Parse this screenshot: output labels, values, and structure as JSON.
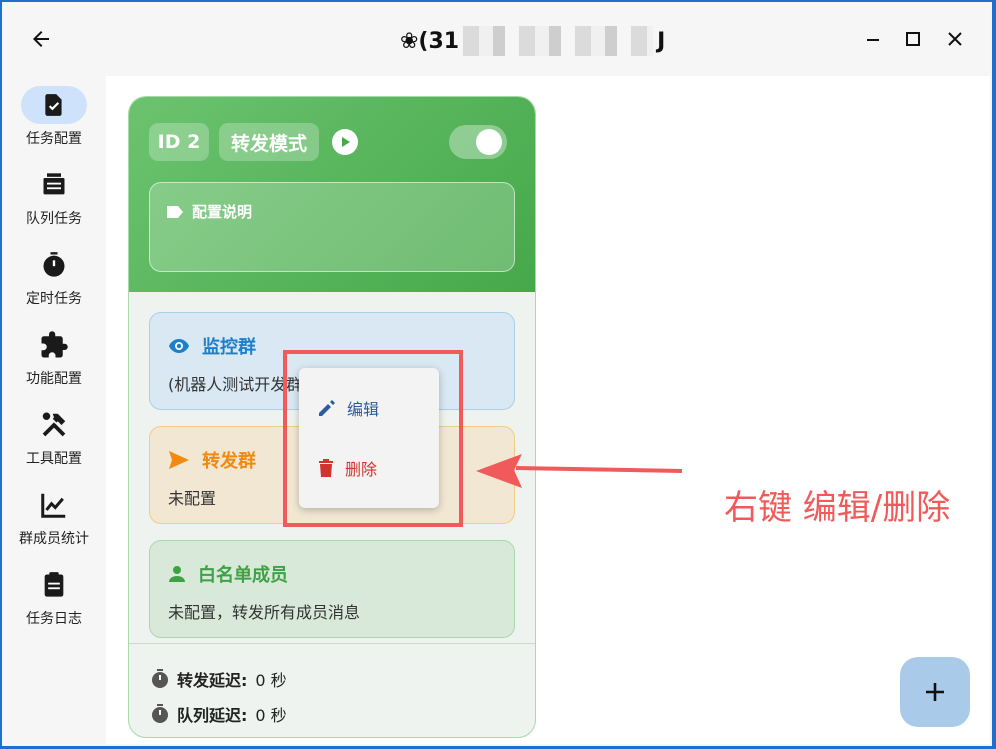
{
  "titlebar": {
    "title_prefix": "❀(31",
    "title_suffix": "J"
  },
  "sidebar": {
    "items": [
      {
        "label": "任务配置",
        "icon": "task-config-icon",
        "active": true
      },
      {
        "label": "队列任务",
        "icon": "queue-icon"
      },
      {
        "label": "定时任务",
        "icon": "timer-icon"
      },
      {
        "label": "功能配置",
        "icon": "puzzle-icon"
      },
      {
        "label": "工具配置",
        "icon": "tools-icon"
      },
      {
        "label": "群成员统计",
        "icon": "chart-icon"
      },
      {
        "label": "任务日志",
        "icon": "clipboard-icon"
      }
    ]
  },
  "card": {
    "id_label": "ID 2",
    "mode_label": "转发模式",
    "toggle_on": true,
    "desc_label": "配置说明",
    "monitor": {
      "title": "监控群",
      "subtitle": "(机器人测试开发群)"
    },
    "forward": {
      "title": "转发群",
      "subtitle": "未配置"
    },
    "whitelist": {
      "title": "白名单成员",
      "subtitle": "未配置，转发所有成员消息"
    },
    "forward_delay": {
      "label": "转发延迟:",
      "value": "0 秒"
    },
    "queue_delay": {
      "label": "队列延迟:",
      "value": "0 秒"
    }
  },
  "context_menu": {
    "edit_label": "编辑",
    "delete_label": "删除"
  },
  "annotation": {
    "text": "右键 编辑/删除",
    "color": "#f05a5a"
  },
  "colors": {
    "accent_green": "#45a84a",
    "active_nav": "#cfe2fb",
    "fab": "#a9cbe9"
  }
}
